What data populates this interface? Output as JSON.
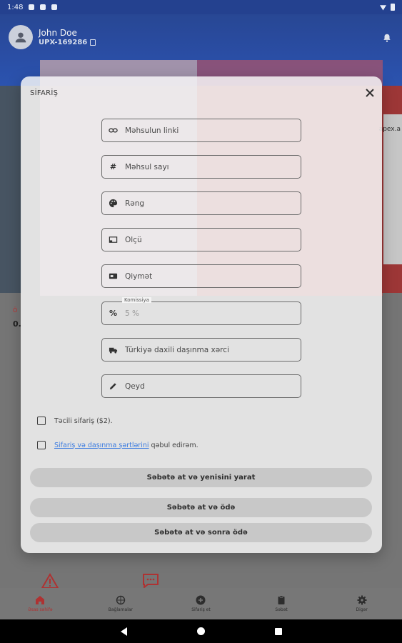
{
  "status_bar": {
    "time": "1:48"
  },
  "header": {
    "user_name": "John Doe",
    "user_id": "UPX-169286"
  },
  "background": {
    "side_text": "apex.a",
    "left_value": "0.",
    "left_red": "Ö"
  },
  "modal": {
    "title": "SİFARİŞ",
    "fields": [
      {
        "icon": "link-icon",
        "placeholder": "Məhsulun linki",
        "value": ""
      },
      {
        "icon": "hash-icon",
        "placeholder": "Məhsul sayı",
        "value": ""
      },
      {
        "icon": "palette-icon",
        "placeholder": "Rəng",
        "value": ""
      },
      {
        "icon": "ruler-icon",
        "placeholder": "Ölçü",
        "value": ""
      },
      {
        "icon": "money-icon",
        "placeholder": "Qiymət",
        "value": ""
      },
      {
        "icon": "percent-icon",
        "legend": "Komissiya",
        "placeholder": "",
        "value": "5 %"
      },
      {
        "icon": "truck-icon",
        "placeholder": "Türkiyə daxili daşınma xərci",
        "value": ""
      },
      {
        "icon": "pencil-icon",
        "placeholder": "Qeyd",
        "value": ""
      }
    ],
    "urgent_label": "Təcili sifariş ($2).",
    "terms_link": "Sifariş və daşınma şərtlərini",
    "terms_suffix": " qəbul edirəm.",
    "buttons": {
      "cart_new": "Səbətə at və yenisini yarat",
      "cart_pay": "Səbətə at və ödə",
      "cart_later": "Səbətə at və sonra ödə"
    }
  },
  "bottom_nav": {
    "items": [
      {
        "icon": "home-icon",
        "label": "Əsas səhifə"
      },
      {
        "icon": "package-icon",
        "label": "Bağlamalar"
      },
      {
        "icon": "plus-circle-icon",
        "label": "Sifariş et"
      },
      {
        "icon": "clipboard-icon",
        "label": "Səbət"
      },
      {
        "icon": "gear-icon",
        "label": "Digər"
      }
    ]
  },
  "colors": {
    "header": "#2d57b7",
    "accent_red": "#b63535",
    "link": "#3b7be0",
    "button": "#c8c8c8"
  }
}
